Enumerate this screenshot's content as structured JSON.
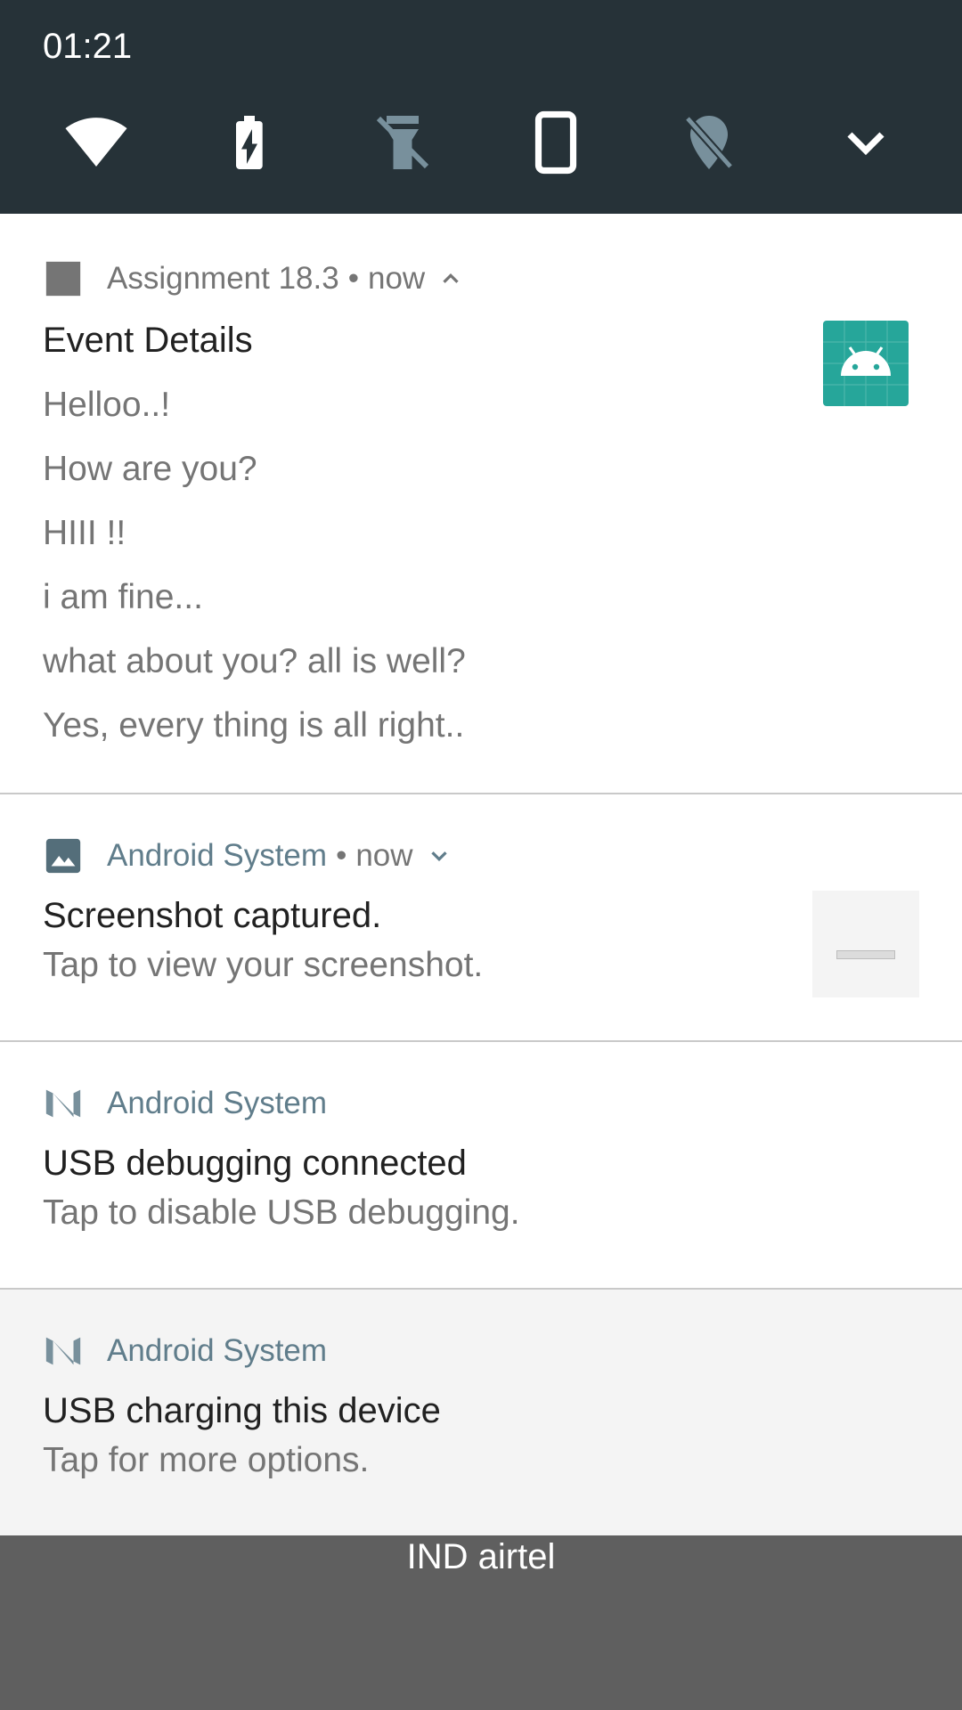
{
  "status": {
    "time": "01:21"
  },
  "quick_settings": {
    "tiles": [
      {
        "icon": "wifi-icon",
        "active": true
      },
      {
        "icon": "battery-saver-icon",
        "active": true
      },
      {
        "icon": "flashlight-off-icon",
        "active": false
      },
      {
        "icon": "auto-rotate-icon",
        "active": true
      },
      {
        "icon": "location-off-icon",
        "active": false
      },
      {
        "icon": "expand-chevron-icon",
        "active": true
      }
    ]
  },
  "notifications": [
    {
      "app_name": "Assignment 18.3",
      "separator": "•",
      "when": "now",
      "expanded": true,
      "title": "Event Details",
      "lines": [
        "Helloo..!",
        "How are you?",
        "HIII !!",
        "i am fine...",
        "what about you? all is well?",
        "Yes, every thing is all right.."
      ],
      "large_icon": "android-robot-icon"
    },
    {
      "app_name": "Android System",
      "separator": "•",
      "when": "now",
      "expanded": false,
      "title": "Screenshot captured.",
      "text": "Tap to view your screenshot.",
      "thumbnail": "screenshot-thumbnail"
    },
    {
      "app_name": "Android System",
      "title": "USB debugging connected",
      "text": "Tap to disable USB debugging."
    },
    {
      "app_name": "Android System",
      "title": "USB charging this device",
      "text": "Tap for more options."
    }
  ],
  "carrier": "IND airtel",
  "colors": {
    "qs_background": "#263238",
    "accent_teal": "#26a69a",
    "system_blue_grey": "#607d8b"
  }
}
